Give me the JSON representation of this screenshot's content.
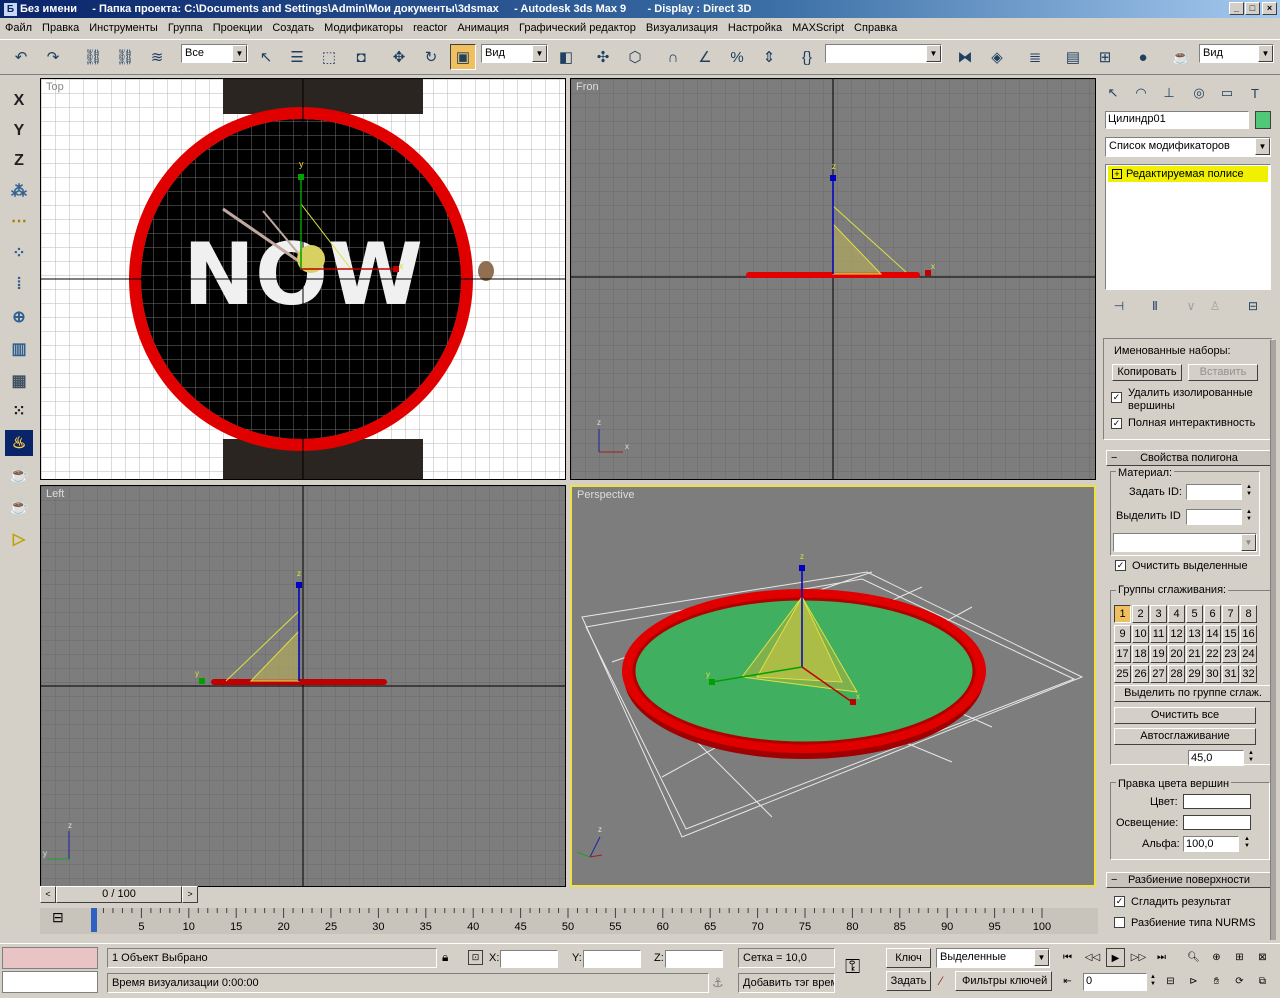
{
  "title": {
    "icon": "3ds-max-icon",
    "text": "Без имени     - Папка проекта: C:\\Documents and Settings\\Admin\\Мои документы\\3dsmax     - Autodesk 3ds Max 9       - Display : Direct 3D"
  },
  "window_buttons": [
    "_",
    "□",
    "×"
  ],
  "menu": [
    "Файл",
    "Правка",
    "Инструменты",
    "Группа",
    "Проекции",
    "Создать",
    "Модификаторы",
    "reactor",
    "Анимация",
    "Графический редактор",
    "Визуализация",
    "Настройка",
    "MAXScript",
    "Справка"
  ],
  "toolbar": {
    "selection_filter": "Все",
    "coord_system": "Вид",
    "named_selection": "",
    "render_type": "Вид"
  },
  "left_toolbar": [
    "X",
    "Y",
    "Z"
  ],
  "viewports": {
    "top": "Top",
    "front": "Fron",
    "left": "Left",
    "perspective": "Perspective"
  },
  "right_panel": {
    "object_name": "Цилиндр01",
    "object_color": "#50c878",
    "modifier_list": "Список модификаторов",
    "stack_item": "Редактируемая полисе",
    "named_sets_label": "Именованные наборы:",
    "copy_btn": "Копировать",
    "paste_btn": "Вставить",
    "delete_isolated": "Удалить изолированные вершины",
    "full_interactivity": "Полная интерактивность",
    "poly_props_header": "Свойства полигона",
    "material_label": "Материал:",
    "set_id_label": "Задать ID:",
    "select_id_label": "Выделить ID",
    "clear_selection": "Очистить выделенные",
    "smoothing_groups_label": "Группы сглаживания:",
    "smoothing_groups": [
      "1",
      "2",
      "3",
      "4",
      "5",
      "6",
      "7",
      "8",
      "9",
      "10",
      "11",
      "12",
      "13",
      "14",
      "15",
      "16",
      "17",
      "18",
      "19",
      "20",
      "21",
      "22",
      "23",
      "24",
      "25",
      "26",
      "27",
      "28",
      "29",
      "30",
      "31",
      "32"
    ],
    "select_by_sg": "Выделить по группе сглаж.",
    "clear_all": "Очистить все",
    "autosmooth": "Автосглаживание",
    "autosmooth_value": "45,0",
    "vertex_color_label": "Правка цвета вершин",
    "color_label": "Цвет:",
    "illum_label": "Освещение:",
    "alpha_label": "Альфа:",
    "alpha_value": "100,0",
    "subdiv_header": "Разбиение поверхности",
    "smooth_result": "Сгладить результат",
    "nurms": "Разбиение типа NURMS"
  },
  "timeline": {
    "frame_counter": "0 / 100",
    "ticks": [
      "0",
      "5",
      "10",
      "15",
      "20",
      "25",
      "30",
      "35",
      "40",
      "45",
      "50",
      "55",
      "60",
      "65",
      "70",
      "75",
      "80",
      "85",
      "90",
      "95",
      "100"
    ]
  },
  "status": {
    "selected": "1 Объект Выбрано",
    "render_time": "Время визуализации  0:00:00",
    "x_label": "X:",
    "y_label": "Y:",
    "z_label": "Z:",
    "grid": "Сетка = 10,0",
    "add_time_tag": "Добавить тэг врем",
    "key_btn": "Ключ",
    "set_btn": "Задать",
    "key_mode": "Выделенные",
    "key_filters": "Фильтры ключей",
    "frame_value": "0"
  }
}
